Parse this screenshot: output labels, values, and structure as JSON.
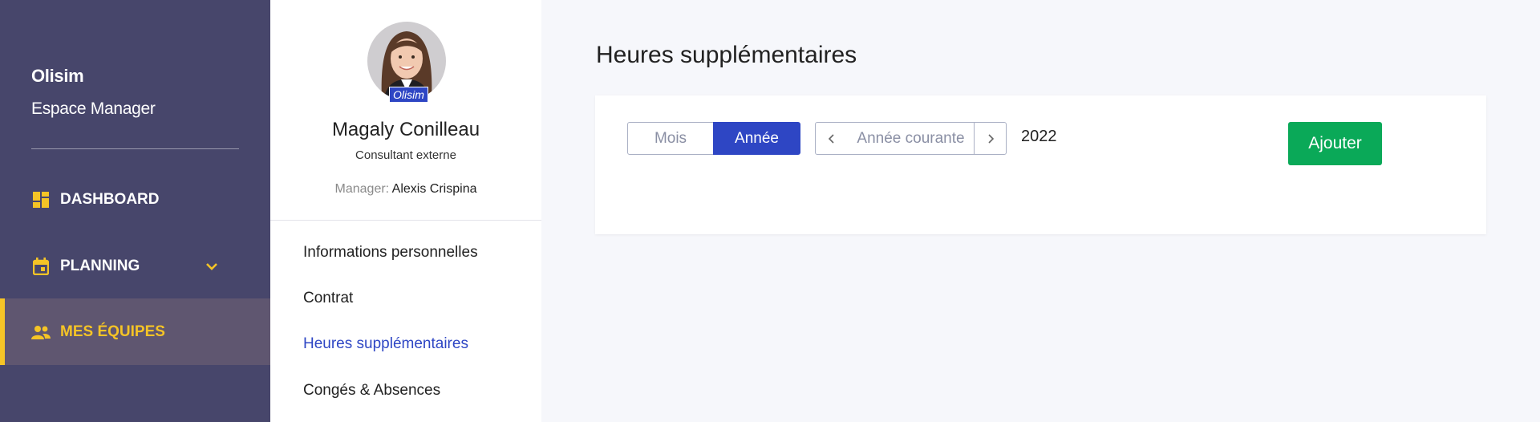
{
  "sidebar": {
    "brand": "Olisim",
    "subtitle": "Espace Manager",
    "items": [
      {
        "label": "DASHBOARD",
        "icon": "dashboard-icon"
      },
      {
        "label": "PLANNING",
        "icon": "calendar-icon",
        "has_submenu": true
      },
      {
        "label": "MES ÉQUIPES",
        "icon": "people-icon",
        "active": true
      }
    ],
    "accent": "#f5c426",
    "background": "#47466b"
  },
  "profile": {
    "badge": "Olisim",
    "name": "Magaly Conilleau",
    "role": "Consultant externe",
    "manager_label": "Manager:",
    "manager_name": "Alexis Crispina",
    "links": [
      {
        "label": "Informations personnelles"
      },
      {
        "label": "Contrat"
      },
      {
        "label": "Heures supplémentaires",
        "active": true
      },
      {
        "label": "Congés & Absences"
      }
    ],
    "active_color": "#2e46c4"
  },
  "main": {
    "title": "Heures supplémentaires",
    "period_toggle": {
      "mois": "Mois",
      "annee": "Année",
      "selected": "Année"
    },
    "current_year_button": "Année courante",
    "year": "2022",
    "add_button": "Ajouter",
    "add_color": "#0aa958"
  }
}
